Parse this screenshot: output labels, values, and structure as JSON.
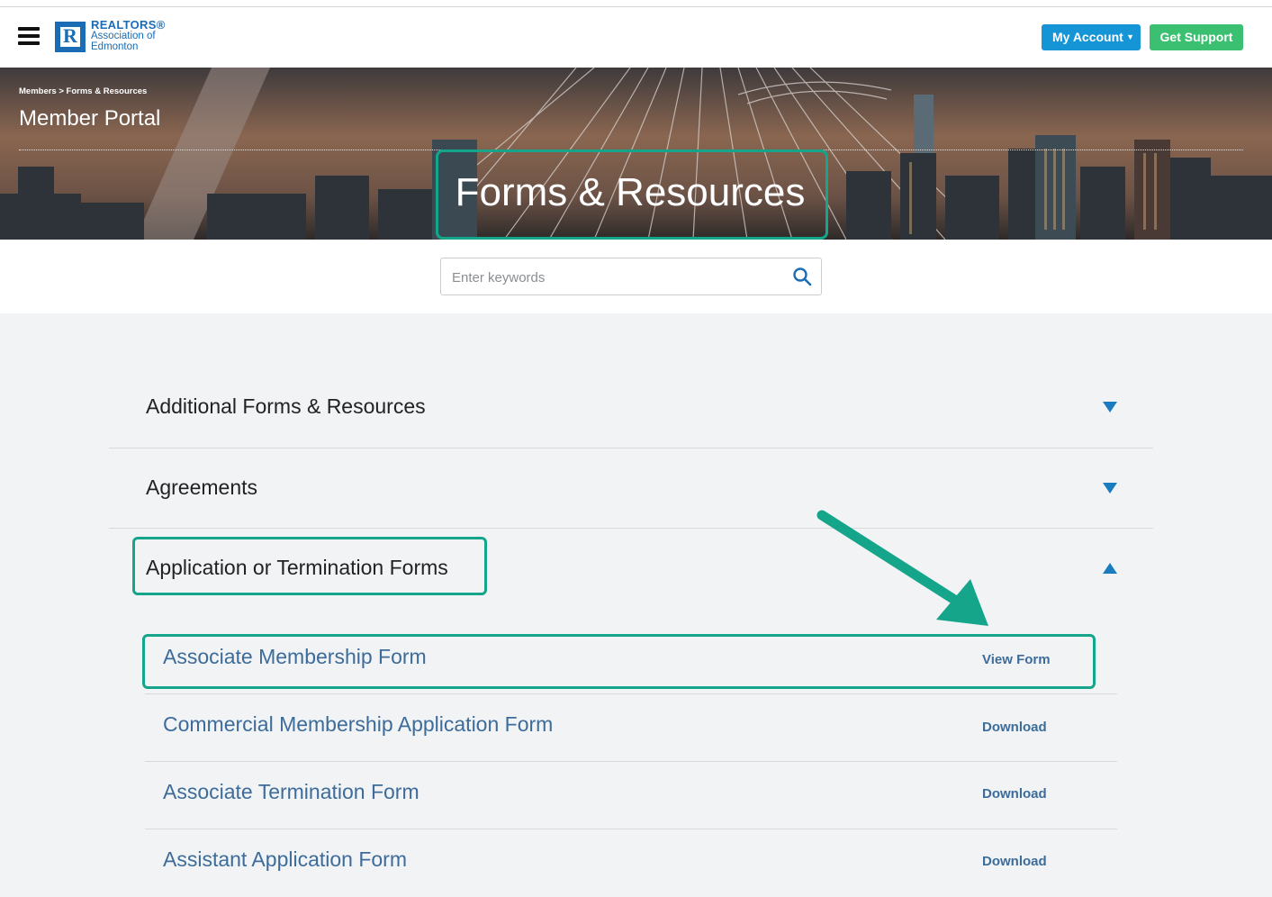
{
  "header": {
    "logo": {
      "line1": "REALTORS®",
      "line2": "Association of",
      "line3": "Edmonton"
    },
    "my_account_label": "My Account",
    "get_support_label": "Get Support"
  },
  "hero": {
    "breadcrumb": "Members > Forms & Resources",
    "portal_title": "Member Portal",
    "page_title": "Forms & Resources"
  },
  "search": {
    "placeholder": "Enter keywords"
  },
  "accordion": [
    {
      "label": "Additional Forms & Resources",
      "expanded": false
    },
    {
      "label": "Agreements",
      "expanded": false
    },
    {
      "label": "Application or Termination Forms",
      "expanded": true
    }
  ],
  "forms": [
    {
      "name": "Associate Membership Form",
      "action": "View Form"
    },
    {
      "name": "Commercial Membership Application Form",
      "action": "Download"
    },
    {
      "name": "Associate Termination Form",
      "action": "Download"
    },
    {
      "name": "Assistant Application Form",
      "action": "Download"
    }
  ],
  "colors": {
    "accent_blue": "#1594d6",
    "support_green": "#3bbf71",
    "highlight": "#14a58a",
    "link": "#3d6c9a",
    "triangle": "#1a7bbf"
  }
}
